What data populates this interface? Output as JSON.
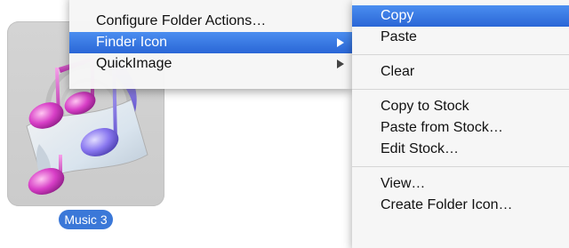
{
  "icon": {
    "name": "music-icon",
    "label": "Music 3"
  },
  "context_menu": {
    "items": [
      {
        "label": "Configure Folder Actions…",
        "submenu": false,
        "selected": false
      },
      {
        "label": "Finder Icon",
        "submenu": true,
        "selected": true
      },
      {
        "label": "QuickImage",
        "submenu": true,
        "selected": false
      }
    ]
  },
  "submenu": {
    "groups": [
      [
        {
          "label": "Copy",
          "selected": true
        },
        {
          "label": "Paste",
          "selected": false
        }
      ],
      [
        {
          "label": "Clear",
          "selected": false
        }
      ],
      [
        {
          "label": "Copy to Stock",
          "selected": false
        },
        {
          "label": "Paste from Stock…",
          "selected": false
        },
        {
          "label": "Edit Stock…",
          "selected": false
        }
      ],
      [
        {
          "label": "View…",
          "selected": false
        },
        {
          "label": "Create Folder Icon…",
          "selected": false
        }
      ]
    ]
  },
  "colors": {
    "selection": "#2f6fdc",
    "label_bg": "#3b78d8",
    "menu_bg": "#f6f6f6",
    "tile_bg": "#d0d0d0"
  }
}
